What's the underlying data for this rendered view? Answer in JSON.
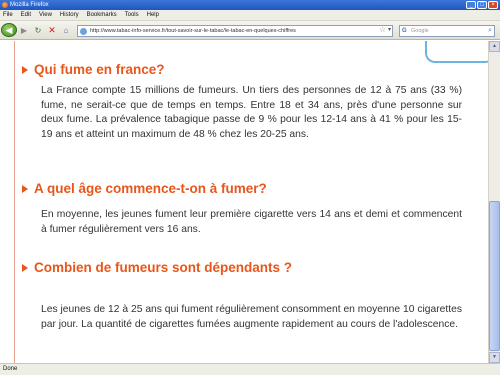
{
  "window": {
    "title": "Mozilla Firefox"
  },
  "menu": [
    "File",
    "Edit",
    "View",
    "History",
    "Bookmarks",
    "Tools",
    "Help"
  ],
  "nav": {
    "url": "http://www.tabac-info-service.fr/tout-savoir-sur-le-tabac/le-tabac-en-quelques-chiffres",
    "search_placeholder": "Google"
  },
  "sections": [
    {
      "heading": "Qui fume en france?",
      "text": "La France compte 15 millions de fumeurs. Un tiers des personnes de 12 à 75 ans (33 %) fume, ne serait-ce que de temps en temps. Entre 18 et 34 ans, près d'une personne sur deux fume. La prévalence tabagique passe de 9 % pour les 12-14 ans à 41 % pour les 15-19 ans et atteint un maximum de 48 % chez les 20-25 ans."
    },
    {
      "heading": "A quel âge commence-t-on à fumer?",
      "text": "En moyenne, les jeunes fument leur première cigarette vers 14 ans et demi et commencent à fumer régulièrement vers 16 ans."
    },
    {
      "heading": "Combien de fumeurs sont dépendants ?",
      "text": "Les jeunes de 12 à 25 ans qui fument régulièrement consomment en moyenne 10 cigarettes par jour. La quantité de cigarettes fumées augmente rapidement au cours de l'adolescence."
    }
  ],
  "status": "Done",
  "colors": {
    "heading": "#e8561a",
    "body_text": "#333333",
    "rule": "#e8a090"
  }
}
